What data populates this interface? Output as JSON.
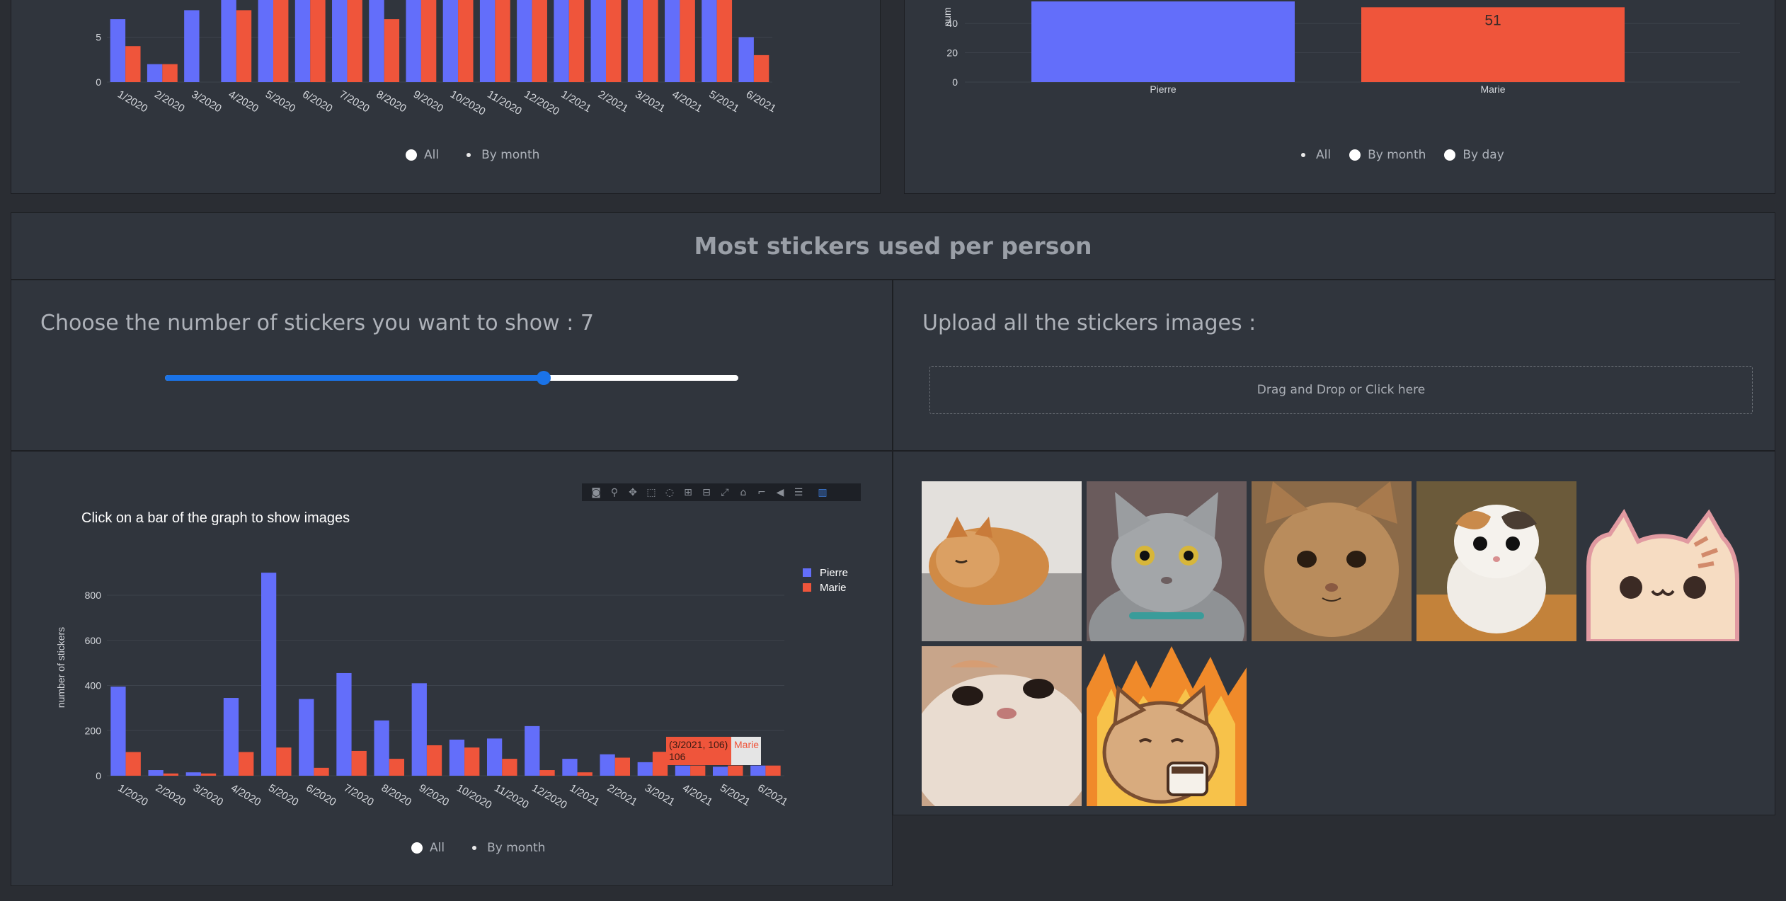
{
  "top_left_chart": {
    "chart_data": {
      "type": "bar",
      "categories": [
        "1/2020",
        "2/2020",
        "3/2020",
        "4/2020",
        "5/2020",
        "6/2020",
        "7/2020",
        "8/2020",
        "9/2020",
        "10/2020",
        "11/2020",
        "12/2020",
        "1/2021",
        "2/2021",
        "3/2021",
        "4/2021",
        "5/2021",
        "6/2021"
      ],
      "series": [
        {
          "name": "Pierre",
          "color": "#636efa",
          "values": [
            7,
            2,
            8,
            12,
            12,
            12,
            12,
            12,
            12,
            12,
            12,
            12,
            12,
            12,
            12,
            12,
            12,
            5
          ]
        },
        {
          "name": "Marie",
          "color": "#ef553b",
          "values": [
            4,
            2,
            0,
            8,
            12,
            12,
            12,
            7,
            12,
            12,
            12,
            12,
            12,
            12,
            12,
            12,
            12,
            3
          ]
        }
      ],
      "yticks": [
        0,
        5
      ],
      "ylim": [
        0,
        10
      ]
    },
    "radios": [
      {
        "label": "All",
        "selected": false
      },
      {
        "label": "By month",
        "selected": true
      }
    ]
  },
  "top_right_chart": {
    "chart_data": {
      "type": "bar",
      "categories": [
        "Pierre",
        "Marie"
      ],
      "series": [
        {
          "name": "",
          "values": [
            55,
            51
          ],
          "colors": [
            "#636efa",
            "#ef553b"
          ]
        }
      ],
      "data_labels": [
        "",
        "51"
      ],
      "yticks": [
        0,
        20,
        40
      ],
      "ylim": [
        0,
        55
      ],
      "ylabel": "num"
    },
    "radios": [
      {
        "label": "All",
        "selected": true
      },
      {
        "label": "By month",
        "selected": false
      },
      {
        "label": "By day",
        "selected": false
      }
    ]
  },
  "section_title": "Most stickers used per person",
  "slider_panel": {
    "heading": "Choose the number of stickers you want to show : 7",
    "slider_value_fraction": 0.66
  },
  "upload_panel": {
    "heading": "Upload all the stickers images :",
    "dropzone_text": "Drag and Drop or Click here"
  },
  "sticker_chart": {
    "chart_data": {
      "type": "bar",
      "title": "Click on a bar of the graph to show images",
      "ylabel": "number of stickers",
      "categories": [
        "1/2020",
        "2/2020",
        "3/2020",
        "4/2020",
        "5/2020",
        "6/2020",
        "7/2020",
        "8/2020",
        "9/2020",
        "10/2020",
        "11/2020",
        "12/2020",
        "1/2021",
        "2/2021",
        "3/2021",
        "4/2021",
        "5/2021",
        "6/2021"
      ],
      "series": [
        {
          "name": "Pierre",
          "color": "#636efa",
          "values": [
            395,
            25,
            15,
            345,
            900,
            340,
            455,
            245,
            410,
            160,
            165,
            220,
            75,
            95,
            60,
            45,
            40,
            45
          ]
        },
        {
          "name": "Marie",
          "color": "#ef553b",
          "values": [
            105,
            10,
            10,
            105,
            125,
            35,
            110,
            75,
            135,
            125,
            75,
            25,
            15,
            80,
            106,
            45,
            45,
            45
          ]
        }
      ],
      "yticks": [
        0,
        200,
        400,
        600,
        800
      ],
      "ylim": [
        0,
        950
      ],
      "legend_position": "top-right"
    },
    "hover": {
      "point": "(3/2021, 106)",
      "value": "106",
      "series": "Marie"
    },
    "radios": [
      {
        "label": "All",
        "selected": false
      },
      {
        "label": "By month",
        "selected": true
      }
    ],
    "modebar_icons": [
      "camera-icon",
      "zoom-icon",
      "pan-icon",
      "box-select-icon",
      "lasso-icon",
      "zoom-in-icon",
      "zoom-out-icon",
      "autoscale-icon",
      "reset-axes-icon",
      "spike-lines-icon",
      "hover-closest-icon",
      "hover-compare-icon",
      "plotly-logo-icon"
    ]
  },
  "stickers": [
    {
      "name": "sticker-sleepy-orange-cat"
    },
    {
      "name": "sticker-grey-cat-staring"
    },
    {
      "name": "sticker-tabby-cat-face"
    },
    {
      "name": "sticker-calico-kitten"
    },
    {
      "name": "sticker-cartoon-cat-peeking"
    },
    {
      "name": "sticker-cat-looking-up"
    },
    {
      "name": "sticker-cartoon-cat-coffee-fire"
    }
  ]
}
